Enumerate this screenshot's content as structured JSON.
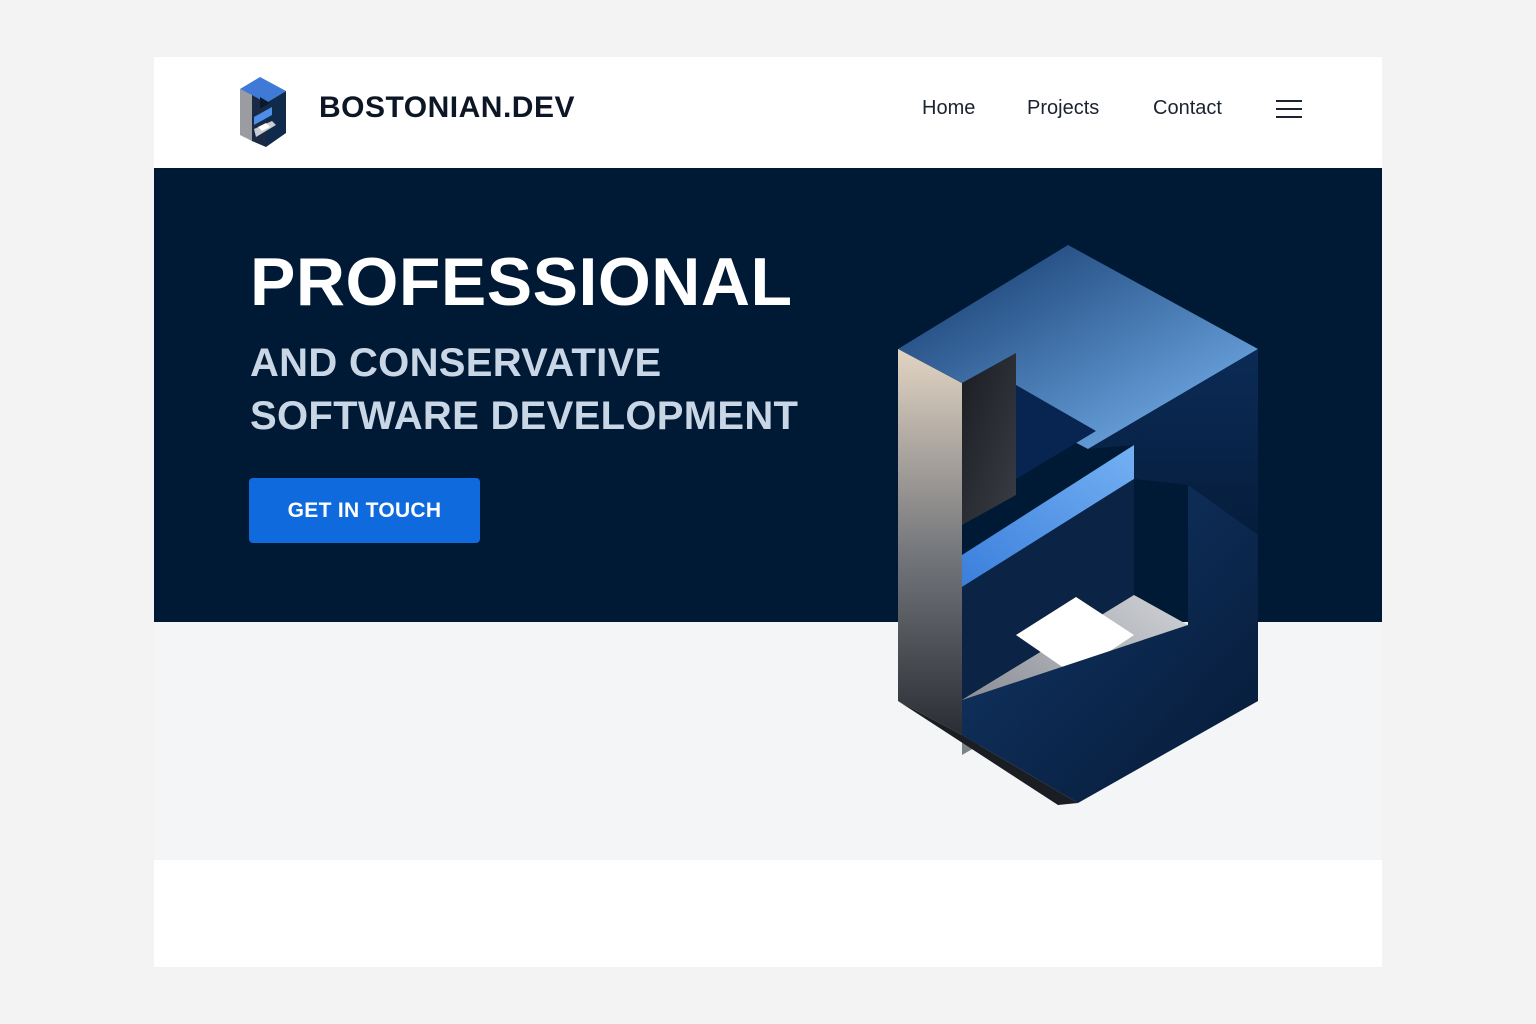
{
  "header": {
    "brand": "BOSTONIAN.DEV",
    "logo_icon": "b-monogram-icon",
    "nav": [
      {
        "label": "Home"
      },
      {
        "label": "Projects"
      },
      {
        "label": "Contact"
      }
    ],
    "menu_icon": "hamburger-menu-icon"
  },
  "hero": {
    "headline": "PROFESSIONAL",
    "subline_1": "AND CONSERVATIVE",
    "subline_2": "SOFTWARE DEVELOPMENT",
    "cta_label": "GET IN TOUCH",
    "illustration_icon": "b-monogram-3d-icon"
  },
  "colors": {
    "page_background": "#f3f3f3",
    "hero_background": "#001a35",
    "accent_blue": "#0f6ade",
    "headline_text": "#ffffff",
    "subline_text": "#c9d6e6",
    "brand_text": "#0c1624"
  }
}
